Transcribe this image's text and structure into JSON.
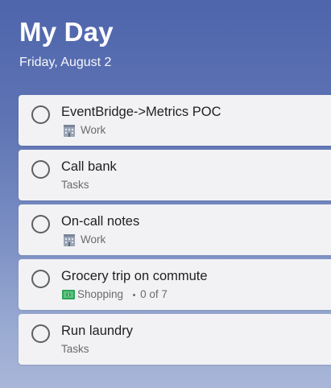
{
  "header": {
    "title": "My Day",
    "date": "Friday, August 2"
  },
  "tasks": [
    {
      "title": "EventBridge->Metrics POC",
      "list": "Work",
      "list_icon": "office-building-icon",
      "steps": ""
    },
    {
      "title": "Call bank",
      "list": "Tasks",
      "list_icon": "",
      "steps": ""
    },
    {
      "title": "On-call notes",
      "list": "Work",
      "list_icon": "office-building-icon",
      "steps": ""
    },
    {
      "title": "Grocery trip on commute",
      "list": "Shopping",
      "list_icon": "dollar-banknote-icon",
      "steps": "0 of 7"
    },
    {
      "title": "Run laundry",
      "list": "Tasks",
      "list_icon": "",
      "steps": ""
    }
  ],
  "colors": {
    "background_top": "#4f65ac",
    "background_bottom": "#a9b6d8",
    "card": "#f2f2f5",
    "checkbox_border": "#5f5f63",
    "meta_text": "#6b6b6e"
  }
}
